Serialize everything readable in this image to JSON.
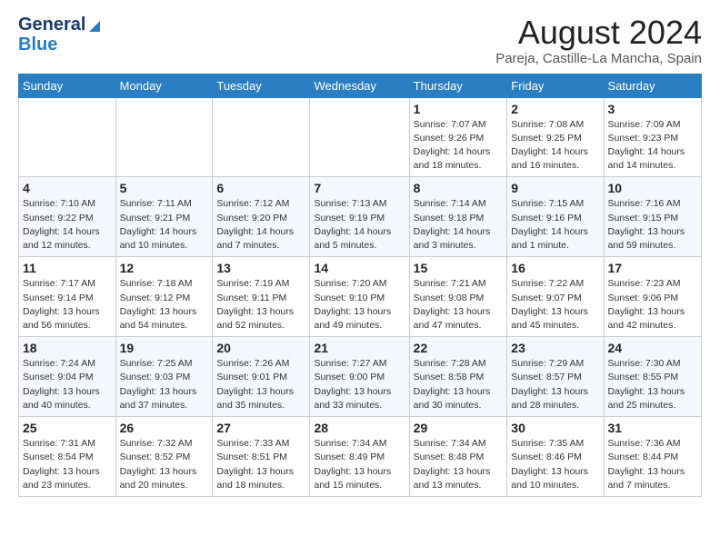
{
  "logo": {
    "line1": "General",
    "line2": "Blue"
  },
  "header": {
    "month_year": "August 2024",
    "location": "Pareja, Castille-La Mancha, Spain"
  },
  "days_of_week": [
    "Sunday",
    "Monday",
    "Tuesday",
    "Wednesday",
    "Thursday",
    "Friday",
    "Saturday"
  ],
  "weeks": [
    [
      {
        "day": "",
        "info": ""
      },
      {
        "day": "",
        "info": ""
      },
      {
        "day": "",
        "info": ""
      },
      {
        "day": "",
        "info": ""
      },
      {
        "day": "1",
        "info": "Sunrise: 7:07 AM\nSunset: 9:26 PM\nDaylight: 14 hours\nand 18 minutes."
      },
      {
        "day": "2",
        "info": "Sunrise: 7:08 AM\nSunset: 9:25 PM\nDaylight: 14 hours\nand 16 minutes."
      },
      {
        "day": "3",
        "info": "Sunrise: 7:09 AM\nSunset: 9:23 PM\nDaylight: 14 hours\nand 14 minutes."
      }
    ],
    [
      {
        "day": "4",
        "info": "Sunrise: 7:10 AM\nSunset: 9:22 PM\nDaylight: 14 hours\nand 12 minutes."
      },
      {
        "day": "5",
        "info": "Sunrise: 7:11 AM\nSunset: 9:21 PM\nDaylight: 14 hours\nand 10 minutes."
      },
      {
        "day": "6",
        "info": "Sunrise: 7:12 AM\nSunset: 9:20 PM\nDaylight: 14 hours\nand 7 minutes."
      },
      {
        "day": "7",
        "info": "Sunrise: 7:13 AM\nSunset: 9:19 PM\nDaylight: 14 hours\nand 5 minutes."
      },
      {
        "day": "8",
        "info": "Sunrise: 7:14 AM\nSunset: 9:18 PM\nDaylight: 14 hours\nand 3 minutes."
      },
      {
        "day": "9",
        "info": "Sunrise: 7:15 AM\nSunset: 9:16 PM\nDaylight: 14 hours\nand 1 minute."
      },
      {
        "day": "10",
        "info": "Sunrise: 7:16 AM\nSunset: 9:15 PM\nDaylight: 13 hours\nand 59 minutes."
      }
    ],
    [
      {
        "day": "11",
        "info": "Sunrise: 7:17 AM\nSunset: 9:14 PM\nDaylight: 13 hours\nand 56 minutes."
      },
      {
        "day": "12",
        "info": "Sunrise: 7:18 AM\nSunset: 9:12 PM\nDaylight: 13 hours\nand 54 minutes."
      },
      {
        "day": "13",
        "info": "Sunrise: 7:19 AM\nSunset: 9:11 PM\nDaylight: 13 hours\nand 52 minutes."
      },
      {
        "day": "14",
        "info": "Sunrise: 7:20 AM\nSunset: 9:10 PM\nDaylight: 13 hours\nand 49 minutes."
      },
      {
        "day": "15",
        "info": "Sunrise: 7:21 AM\nSunset: 9:08 PM\nDaylight: 13 hours\nand 47 minutes."
      },
      {
        "day": "16",
        "info": "Sunrise: 7:22 AM\nSunset: 9:07 PM\nDaylight: 13 hours\nand 45 minutes."
      },
      {
        "day": "17",
        "info": "Sunrise: 7:23 AM\nSunset: 9:06 PM\nDaylight: 13 hours\nand 42 minutes."
      }
    ],
    [
      {
        "day": "18",
        "info": "Sunrise: 7:24 AM\nSunset: 9:04 PM\nDaylight: 13 hours\nand 40 minutes."
      },
      {
        "day": "19",
        "info": "Sunrise: 7:25 AM\nSunset: 9:03 PM\nDaylight: 13 hours\nand 37 minutes."
      },
      {
        "day": "20",
        "info": "Sunrise: 7:26 AM\nSunset: 9:01 PM\nDaylight: 13 hours\nand 35 minutes."
      },
      {
        "day": "21",
        "info": "Sunrise: 7:27 AM\nSunset: 9:00 PM\nDaylight: 13 hours\nand 33 minutes."
      },
      {
        "day": "22",
        "info": "Sunrise: 7:28 AM\nSunset: 8:58 PM\nDaylight: 13 hours\nand 30 minutes."
      },
      {
        "day": "23",
        "info": "Sunrise: 7:29 AM\nSunset: 8:57 PM\nDaylight: 13 hours\nand 28 minutes."
      },
      {
        "day": "24",
        "info": "Sunrise: 7:30 AM\nSunset: 8:55 PM\nDaylight: 13 hours\nand 25 minutes."
      }
    ],
    [
      {
        "day": "25",
        "info": "Sunrise: 7:31 AM\nSunset: 8:54 PM\nDaylight: 13 hours\nand 23 minutes."
      },
      {
        "day": "26",
        "info": "Sunrise: 7:32 AM\nSunset: 8:52 PM\nDaylight: 13 hours\nand 20 minutes."
      },
      {
        "day": "27",
        "info": "Sunrise: 7:33 AM\nSunset: 8:51 PM\nDaylight: 13 hours\nand 18 minutes."
      },
      {
        "day": "28",
        "info": "Sunrise: 7:34 AM\nSunset: 8:49 PM\nDaylight: 13 hours\nand 15 minutes."
      },
      {
        "day": "29",
        "info": "Sunrise: 7:34 AM\nSunset: 8:48 PM\nDaylight: 13 hours\nand 13 minutes."
      },
      {
        "day": "30",
        "info": "Sunrise: 7:35 AM\nSunset: 8:46 PM\nDaylight: 13 hours\nand 10 minutes."
      },
      {
        "day": "31",
        "info": "Sunrise: 7:36 AM\nSunset: 8:44 PM\nDaylight: 13 hours\nand 7 minutes."
      }
    ]
  ]
}
